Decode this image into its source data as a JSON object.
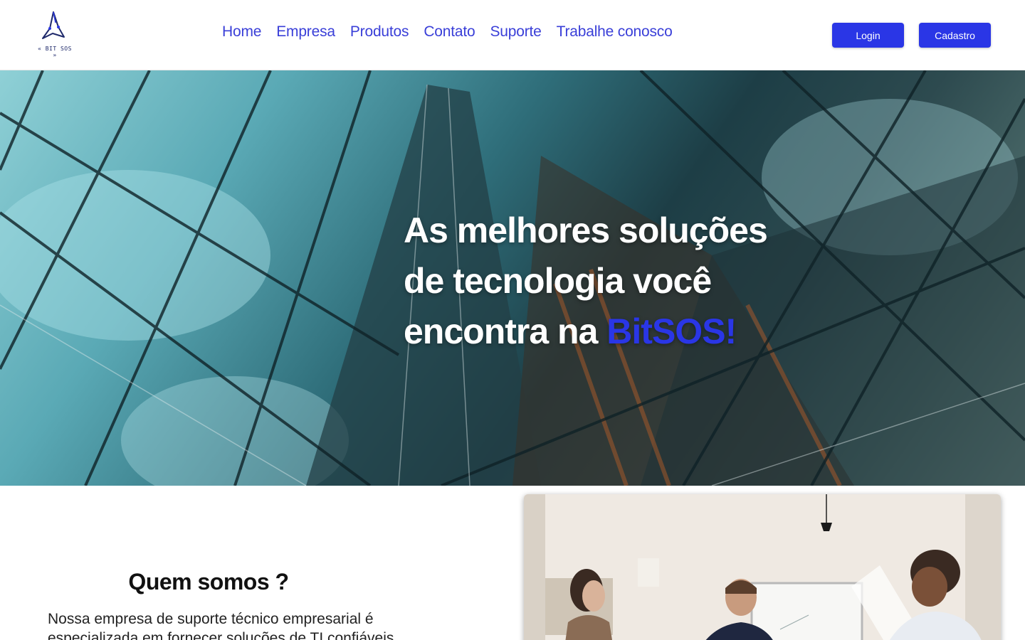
{
  "header": {
    "logo_alt": "BitSOS logo",
    "logo_text": "« BIT SOS »",
    "nav": [
      {
        "label": "Home"
      },
      {
        "label": "Empresa"
      },
      {
        "label": "Produtos"
      },
      {
        "label": "Contato"
      },
      {
        "label": "Suporte"
      },
      {
        "label": "Trabalhe conosco"
      }
    ],
    "login_label": "Login",
    "cadastro_label": "Cadastro"
  },
  "hero": {
    "line1": "As melhores soluções",
    "line2": "de tecnologia você",
    "line3_prefix": "encontra na ",
    "brand": "BitSOS!",
    "image_alt": "Glass skyscraper facade viewed from below"
  },
  "about": {
    "title": "Quem somos ?",
    "text": "Nossa empresa de suporte técnico empresarial é especializada em fornecer soluções de TI confiáveis e",
    "image_alt": "Team meeting at a whiteboard"
  },
  "colors": {
    "accent": "#2a36e6",
    "nav_link": "#3a3fd8"
  }
}
